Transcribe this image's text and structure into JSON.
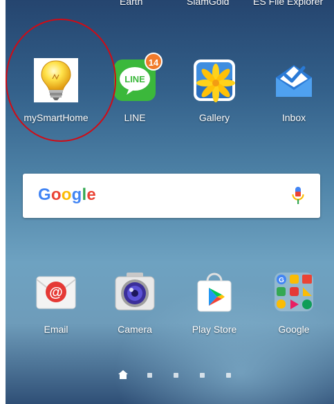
{
  "top_row_labels": [
    "Earth",
    "SiamGold",
    "ES File Explorer"
  ],
  "apps": [
    {
      "label": "mySmartHome",
      "icon": "lightbulb-icon"
    },
    {
      "label": "LINE",
      "icon": "line-icon",
      "badge": "14"
    },
    {
      "label": "Gallery",
      "icon": "gallery-icon"
    },
    {
      "label": "Inbox",
      "icon": "inbox-icon"
    },
    {
      "label": "Email",
      "icon": "email-icon"
    },
    {
      "label": "Camera",
      "icon": "camera-icon"
    },
    {
      "label": "Play Store",
      "icon": "play-store-icon"
    },
    {
      "label": "Google",
      "icon": "google-folder-icon"
    }
  ],
  "search": {
    "logo_letters": [
      "G",
      "o",
      "o",
      "g",
      "l",
      "e"
    ],
    "logo_colors": [
      "#4285f4",
      "#ea4335",
      "#fbbc05",
      "#4285f4",
      "#34a853",
      "#ea4335"
    ],
    "mic_icon": "mic-icon"
  },
  "page_indicator": {
    "pages": 5,
    "current": 1,
    "home_icon": "home-icon"
  },
  "annotation": {
    "highlight_color": "#d20a14",
    "target": "mySmartHome"
  }
}
